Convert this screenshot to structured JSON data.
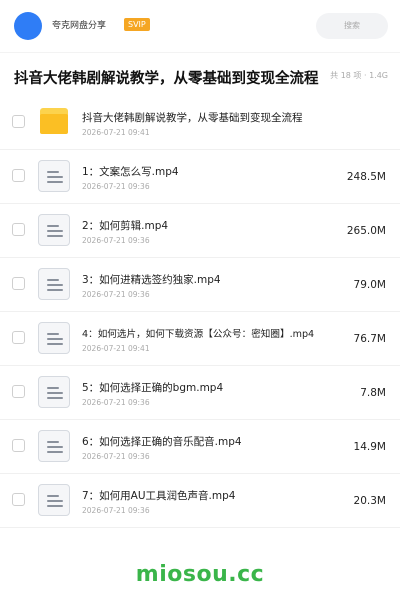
{
  "header": {
    "share_name": "夸克网盘分享",
    "badge": "SVIP",
    "search_placeholder": "搜索"
  },
  "folder": {
    "title": "抖音大佬韩剧解说教学，从零基础到变现全流程",
    "meta": "共 18 项 · 1.4G"
  },
  "files": [
    {
      "name": "抖音大佬韩剧解说教学，从零基础到变现全流程",
      "date": "2026-07-21 09:41",
      "size": "",
      "type": "folder"
    },
    {
      "name": "1：文案怎么写.mp4",
      "date": "2026-07-21 09:36",
      "size": "248.5M",
      "type": "video"
    },
    {
      "name": "2：如何剪辑.mp4",
      "date": "2026-07-21 09:36",
      "size": "265.0M",
      "type": "video"
    },
    {
      "name": "3：如何进精选签约独家.mp4",
      "date": "2026-07-21 09:36",
      "size": "79.0M",
      "type": "video"
    },
    {
      "name": "4：如何选片，如何下载资源【公众号：密知圈】.mp4",
      "date": "2026-07-21 09:41",
      "size": "76.7M",
      "type": "video"
    },
    {
      "name": "5：如何选择正确的bgm.mp4",
      "date": "2026-07-21 09:36",
      "size": "7.8M",
      "type": "video"
    },
    {
      "name": "6：如何选择正确的音乐配音.mp4",
      "date": "2026-07-21 09:36",
      "size": "14.9M",
      "type": "video"
    },
    {
      "name": "7：如何用AU工具润色声音.mp4",
      "date": "2026-07-21 09:36",
      "size": "20.3M",
      "type": "video"
    }
  ],
  "watermark": "miosou.cc",
  "colors": {
    "accent": "#2f7df6",
    "badge": "#f5a623",
    "folder": "#fbbf24",
    "watermark": "#3ab54a"
  }
}
